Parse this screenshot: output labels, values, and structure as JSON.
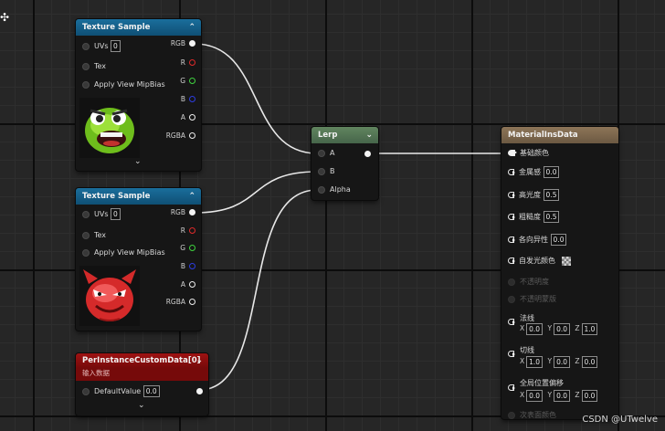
{
  "texture_sample_1": {
    "title": "Texture Sample",
    "inputs": [
      {
        "label": "UVs",
        "value": "0"
      },
      {
        "label": "Tex",
        "value": ""
      },
      {
        "label": "Apply View MipBias",
        "value": ""
      }
    ],
    "outputs": [
      "RGB",
      "R",
      "G",
      "B",
      "A",
      "RGBA"
    ],
    "preview": "green-face-texture"
  },
  "texture_sample_2": {
    "title": "Texture Sample",
    "inputs": [
      {
        "label": "UVs",
        "value": "0"
      },
      {
        "label": "Tex",
        "value": ""
      },
      {
        "label": "Apply View MipBias",
        "value": ""
      }
    ],
    "outputs": [
      "RGB",
      "R",
      "G",
      "B",
      "A",
      "RGBA"
    ],
    "preview": "red-devil-texture"
  },
  "per_instance": {
    "title": "PerInstanceCustomData[0]",
    "subtitle": "输入数据",
    "input_label": "DefaultValue",
    "input_value": "0.0"
  },
  "lerp": {
    "title": "Lerp",
    "inputs": [
      "A",
      "B",
      "Alpha"
    ]
  },
  "material": {
    "title": "MaterialInsData",
    "base_color": "基础颜色",
    "metallic": {
      "label": "金属感",
      "value": "0.0"
    },
    "specular": {
      "label": "高光度",
      "value": "0.5"
    },
    "roughness": {
      "label": "粗糙度",
      "value": "0.5"
    },
    "anisotropy": {
      "label": "各向异性",
      "value": "0.0"
    },
    "emissive": {
      "label": "自发光颜色"
    },
    "opacity": "不透明度",
    "opacity_mask": "不透明蒙版",
    "normal": {
      "label": "法线",
      "x": "0.0",
      "y": "0.0",
      "z": "1.0"
    },
    "tangent": {
      "label": "切线",
      "x": "1.0",
      "y": "0.0",
      "z": "0.0"
    },
    "wpo": {
      "label": "全局位置偏移",
      "x": "0.0",
      "y": "0.0",
      "z": "0.0"
    },
    "last_row": "次表面颜色",
    "axis_x": "X",
    "axis_y": "Y",
    "axis_z": "Z"
  },
  "watermark": "CSDN @UTwelve",
  "colors": {
    "texture_header": "#1a6e9c",
    "lerp_header": "#61855f",
    "material_header": "#8d7558",
    "custom_data_header": "#9e1212",
    "pin_r": "#e02a2a",
    "pin_g": "#3fd33f",
    "pin_b": "#2d3de0"
  }
}
